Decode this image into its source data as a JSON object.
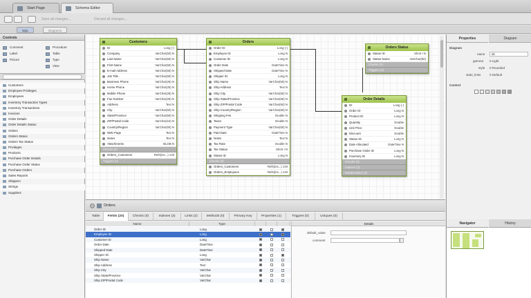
{
  "tabs": [
    {
      "label": "Start Page"
    },
    {
      "label": "Schema Editor"
    }
  ],
  "toolbar": {
    "save": "Save all changes...",
    "discard": "Discard all changes..."
  },
  "subtabs": [
    "SQL",
    "Diagrams"
  ],
  "controls": {
    "title": "Controls",
    "items": [
      "Comment",
      "Procedure",
      "Label",
      "Table",
      "Picture",
      "Type",
      "",
      "View"
    ]
  },
  "tables": [
    "Customers",
    "Employee Privileges",
    "Employees",
    "Inventory Transaction Types",
    "Inventory Transactions",
    "Invoices",
    "Order Details",
    "Order Details Status",
    "Orders",
    "Orders Status",
    "Orders Tax Status",
    "Privileges",
    "Products",
    "Purchase Order Details",
    "Purchase Order Status",
    "Purchase Orders",
    "Sales Reports",
    "Shippers",
    "Strings",
    "Suppliers"
  ],
  "entities": {
    "customers": {
      "title": "Customers",
      "rows": [
        [
          "ID",
          "Long (-)"
        ],
        [
          "Company",
          "VarChar(50) N"
        ],
        [
          "Last Name",
          "VarChar(50) N"
        ],
        [
          "First Name",
          "VarChar(50) N"
        ],
        [
          "E-mail Address",
          "VarChar(50) N"
        ],
        [
          "Job Title",
          "VarChar(50) N"
        ],
        [
          "Business Phone",
          "VarChar(25) N"
        ],
        [
          "Home Phone",
          "VarChar(25) N"
        ],
        [
          "Mobile Phone",
          "VarChar(25) N"
        ],
        [
          "Fax Number",
          "VarChar(25) N"
        ],
        [
          "Address",
          "Text N"
        ],
        [
          "City",
          "VarChar(50) N"
        ],
        [
          "State/Province",
          "VarChar(50) N"
        ],
        [
          "ZIP/Postal Code",
          "VarChar(15) N"
        ],
        [
          "Country/Region",
          "VarChar(50) N"
        ],
        [
          "Web Page",
          "Text N"
        ],
        [
          "Notes",
          "Text N"
        ],
        [
          "Attachments",
          "BLOB N"
        ]
      ],
      "sec1": "Checks (0)",
      "link": [
        "Orders_Customers",
        "Refs(ins...) 1:M"
      ],
      "sec2": "Triggers (0)"
    },
    "orders": {
      "title": "Orders",
      "rows": [
        [
          "Order ID",
          "Long (-)"
        ],
        [
          "Employee ID",
          "Long N"
        ],
        [
          "Customer ID",
          "Long N"
        ],
        [
          "Order Date",
          "DateTime N"
        ],
        [
          "Shipped Date",
          "DateTime N"
        ],
        [
          "Shipper ID",
          "Long N"
        ],
        [
          "Ship Name",
          "VarChar(50) N"
        ],
        [
          "Ship Address",
          "Text N"
        ],
        [
          "Ship City",
          "VarChar(50) N"
        ],
        [
          "Ship State/Province",
          "VarChar(50) N"
        ],
        [
          "Ship ZIP/Postal Code",
          "VarChar(50) N"
        ],
        [
          "Ship Country/Region",
          "VarChar(50) N"
        ],
        [
          "Shipping Fee",
          "Double N"
        ],
        [
          "Taxes",
          "Double N"
        ],
        [
          "Payment Type",
          "VarChar(50) N"
        ],
        [
          "Paid Date",
          "DateTime N"
        ],
        [
          "Notes",
          "Text N"
        ],
        [
          "Tax Rate",
          "Double N"
        ],
        [
          "Tax Status",
          "Short I N"
        ],
        [
          "Status ID",
          "Long N"
        ]
      ],
      "sec1": "Checks (0)",
      "link1": [
        "Orders_Customers",
        "Refs(ins...) 1:M"
      ],
      "link2": [
        "Orders_Employees",
        "Refs(ins...) 1:M"
      ]
    },
    "status": {
      "title": "Orders Status",
      "rows": [
        [
          "Status ID",
          "Short I N"
        ],
        [
          "Status Name",
          "VarChar(50)"
        ]
      ],
      "sec1": "Checks (0)",
      "sec2": "Triggers (0)"
    },
    "details": {
      "title": "Order Details",
      "rows": [
        [
          "ID",
          "Long (-)"
        ],
        [
          "Order ID",
          "Long N"
        ],
        [
          "Product ID",
          "Long N"
        ],
        [
          "Quantity",
          "Double"
        ],
        [
          "Unit Price",
          "Double"
        ],
        [
          "Discount",
          "Double"
        ],
        [
          "Status ID",
          "Long N"
        ],
        [
          "Date Allocated",
          "DateTime N"
        ],
        [
          "Purchase Order ID",
          "Long N"
        ],
        [
          "Inventory ID",
          "Long N"
        ]
      ],
      "sec1": "Checks (0)",
      "sec2": "Indexes (3)",
      "sec3": "Relationships (3)"
    }
  },
  "bottom": {
    "title": "Orders",
    "tabs": [
      "Table",
      "Fields (20)",
      "Checks (0)",
      "Indexes (3)",
      "Links (2)",
      "Methods (0)",
      "Primary Key",
      "Properties (1)",
      "Triggers (0)",
      "Uniques (0)"
    ],
    "headers": [
      "Name",
      "Type",
      "",
      "",
      "",
      "Details"
    ],
    "rows": [
      [
        "Order ID",
        "Long"
      ],
      [
        "Employee ID",
        "Long"
      ],
      [
        "Customer ID",
        "Long"
      ],
      [
        "Order Date",
        "DateTime"
      ],
      [
        "Shipped Date",
        "DateTime"
      ],
      [
        "Shipper ID",
        "Long"
      ],
      [
        "Ship Name",
        "VarChar"
      ],
      [
        "Ship Address",
        "Text"
      ],
      [
        "Ship City",
        "VarChar"
      ],
      [
        "Ship State/Province",
        "VarChar"
      ],
      [
        "Ship ZIP/Postal Code",
        "VarChar"
      ]
    ],
    "details": {
      "default_label": "default_value",
      "comment_label": "comment"
    }
  },
  "properties": {
    "tabs": [
      "Properties",
      "Diagram"
    ],
    "sec1": "Diagram",
    "name_label": "name",
    "name_val": "d1",
    "gamma_label": "gamma",
    "gamma_val": "0 Light",
    "style_label": "style",
    "style_val": "0 Rounded",
    "state_label": "state_links",
    "state_val": "0 Default",
    "sec2": "Control"
  },
  "navigator": {
    "tabs": [
      "Navigator",
      "History"
    ]
  }
}
